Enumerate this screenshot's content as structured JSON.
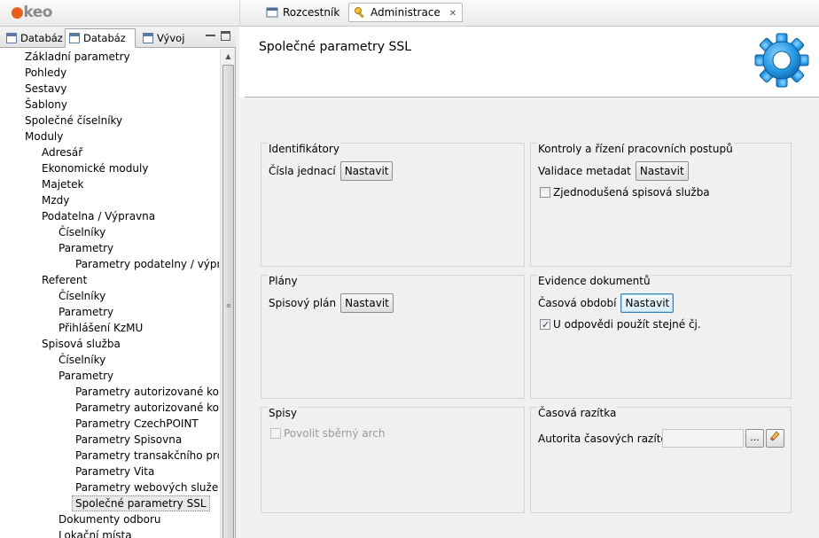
{
  "app": {
    "logo_text": "keo"
  },
  "editor_tabs": [
    {
      "label": "Rozcestník",
      "icon": "window-icon"
    },
    {
      "label": "Administrace",
      "icon": "key-icon",
      "close": "✕"
    }
  ],
  "view_tabs": [
    {
      "label": "Databáz"
    },
    {
      "label": "Databáz"
    },
    {
      "label": "Vývoj"
    }
  ],
  "tree": [
    {
      "label": "Základní parametry",
      "level": 0
    },
    {
      "label": "Pohledy",
      "level": 0
    },
    {
      "label": "Sestavy",
      "level": 0
    },
    {
      "label": "Šablony",
      "level": 0
    },
    {
      "label": "Společné číselníky",
      "level": 0
    },
    {
      "label": "Moduly",
      "level": 0
    },
    {
      "label": "Adresář",
      "level": 1
    },
    {
      "label": "Ekonomické moduly",
      "level": 1
    },
    {
      "label": "Majetek",
      "level": 1
    },
    {
      "label": "Mzdy",
      "level": 1
    },
    {
      "label": "Podatelna / Výpravna",
      "level": 1
    },
    {
      "label": "Číselníky",
      "level": 2
    },
    {
      "label": "Parametry",
      "level": 2
    },
    {
      "label": "Parametry podatelny / výpravn",
      "level": 3
    },
    {
      "label": "Referent",
      "level": 1
    },
    {
      "label": "Číselníky",
      "level": 2
    },
    {
      "label": "Parametry",
      "level": 2
    },
    {
      "label": "Přihlášení KzMU",
      "level": 2
    },
    {
      "label": "Spisová služba",
      "level": 1
    },
    {
      "label": "Číselníky",
      "level": 2
    },
    {
      "label": "Parametry",
      "level": 2
    },
    {
      "label": "Parametry autorizované konve",
      "level": 3
    },
    {
      "label": "Parametry autorizované konve",
      "level": 3
    },
    {
      "label": "Parametry CzechPOINT",
      "level": 3
    },
    {
      "label": "Parametry Spisovna",
      "level": 3
    },
    {
      "label": "Parametry transakčního protok",
      "level": 3
    },
    {
      "label": "Parametry Vita",
      "level": 3
    },
    {
      "label": "Parametry webových služeb",
      "level": 3
    },
    {
      "label": "Společné parametry SSL",
      "level": 3,
      "selected": true
    },
    {
      "label": "Dokumenty odboru",
      "level": 2
    },
    {
      "label": "Lokační místa",
      "level": 2
    }
  ],
  "main": {
    "title": "Společné parametry SSL",
    "groups": {
      "identifiers": {
        "title": "Identifikátory",
        "label": "Čísla jednací",
        "button": "Nastavit"
      },
      "workflow": {
        "title": "Kontroly a řízení pracovních postupů",
        "label": "Validace metadat",
        "button": "Nastavit",
        "checkbox": "Zjednodušená spisová služba",
        "checked": false
      },
      "plans": {
        "title": "Plány",
        "label": "Spisový plán",
        "button": "Nastavit"
      },
      "evidence": {
        "title": "Evidence dokumentů",
        "label": "Časová období",
        "button": "Nastavit",
        "checkbox": "U odpovědi použít stejné čj.",
        "checked": true
      },
      "files": {
        "title": "Spisy",
        "checkbox": "Povolit sběrný arch",
        "checked": false,
        "disabled": true
      },
      "timestamps": {
        "title": "Časová razítka",
        "label": "Autorita časových razítek",
        "value": "",
        "browse_button": "...",
        "edit_icon": "eraser-icon"
      }
    }
  },
  "colors": {
    "logo_accent": "#e8601c",
    "focus_border": "#3c7fb1",
    "gear_blue": "#1d8fd8"
  }
}
